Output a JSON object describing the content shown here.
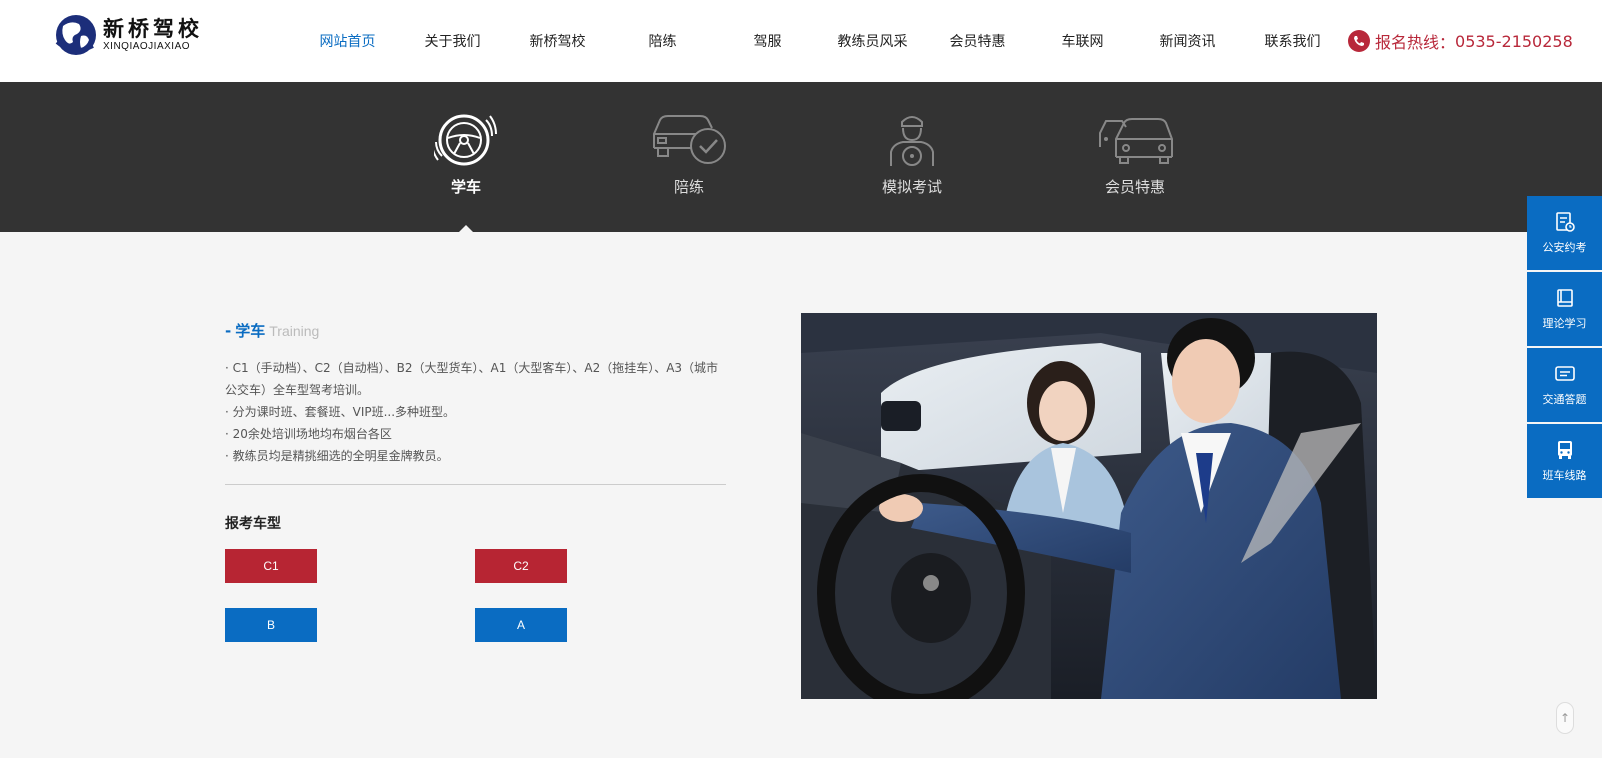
{
  "header": {
    "logo_cn": "新桥驾校",
    "logo_en": "XINQIAOJIAXIAO",
    "nav": [
      {
        "label": "网站首页",
        "active": true
      },
      {
        "label": "关于我们"
      },
      {
        "label": "新桥驾校"
      },
      {
        "label": "陪练"
      },
      {
        "label": "驾服"
      },
      {
        "label": "教练员风采"
      },
      {
        "label": "会员特惠"
      },
      {
        "label": "车联网"
      },
      {
        "label": "新闻资讯"
      },
      {
        "label": "联系我们"
      }
    ],
    "hotline_label": "报名热线：",
    "hotline_number": "0535-2150258"
  },
  "tabs": [
    {
      "label": "学车",
      "icon": "steering-wheel-icon",
      "active": true
    },
    {
      "label": "陪练",
      "icon": "car-check-icon"
    },
    {
      "label": "模拟考试",
      "icon": "driver-icon"
    },
    {
      "label": "会员特惠",
      "icon": "cars-icon"
    }
  ],
  "section": {
    "title_cn": "学车",
    "title_en": "Training",
    "lines": [
      "· C1（手动档）、C2（自动档）、B2（大型货车）、A1（大型客车）、A2（拖挂车）、A3（城市公交车）全车型驾考培训。",
      "· 分为课时班、套餐班、VIP班...多种班型。",
      "· 20余处培训场地均布烟台各区",
      "· 教练员均是精挑细选的全明星金牌教员。"
    ],
    "type_title": "报考车型",
    "types": [
      "C1",
      "C2",
      "B",
      "A"
    ]
  },
  "sidebar": [
    {
      "label": "公安约考",
      "icon": "exam-doc-icon"
    },
    {
      "label": "理论学习",
      "icon": "book-icon"
    },
    {
      "label": "交通答题",
      "icon": "message-icon"
    },
    {
      "label": "班车线路",
      "icon": "bus-icon"
    }
  ],
  "colors": {
    "brand_blue": "#0a6cc2",
    "brand_red": "#b72533",
    "band": "#333333"
  },
  "totop": "↑"
}
